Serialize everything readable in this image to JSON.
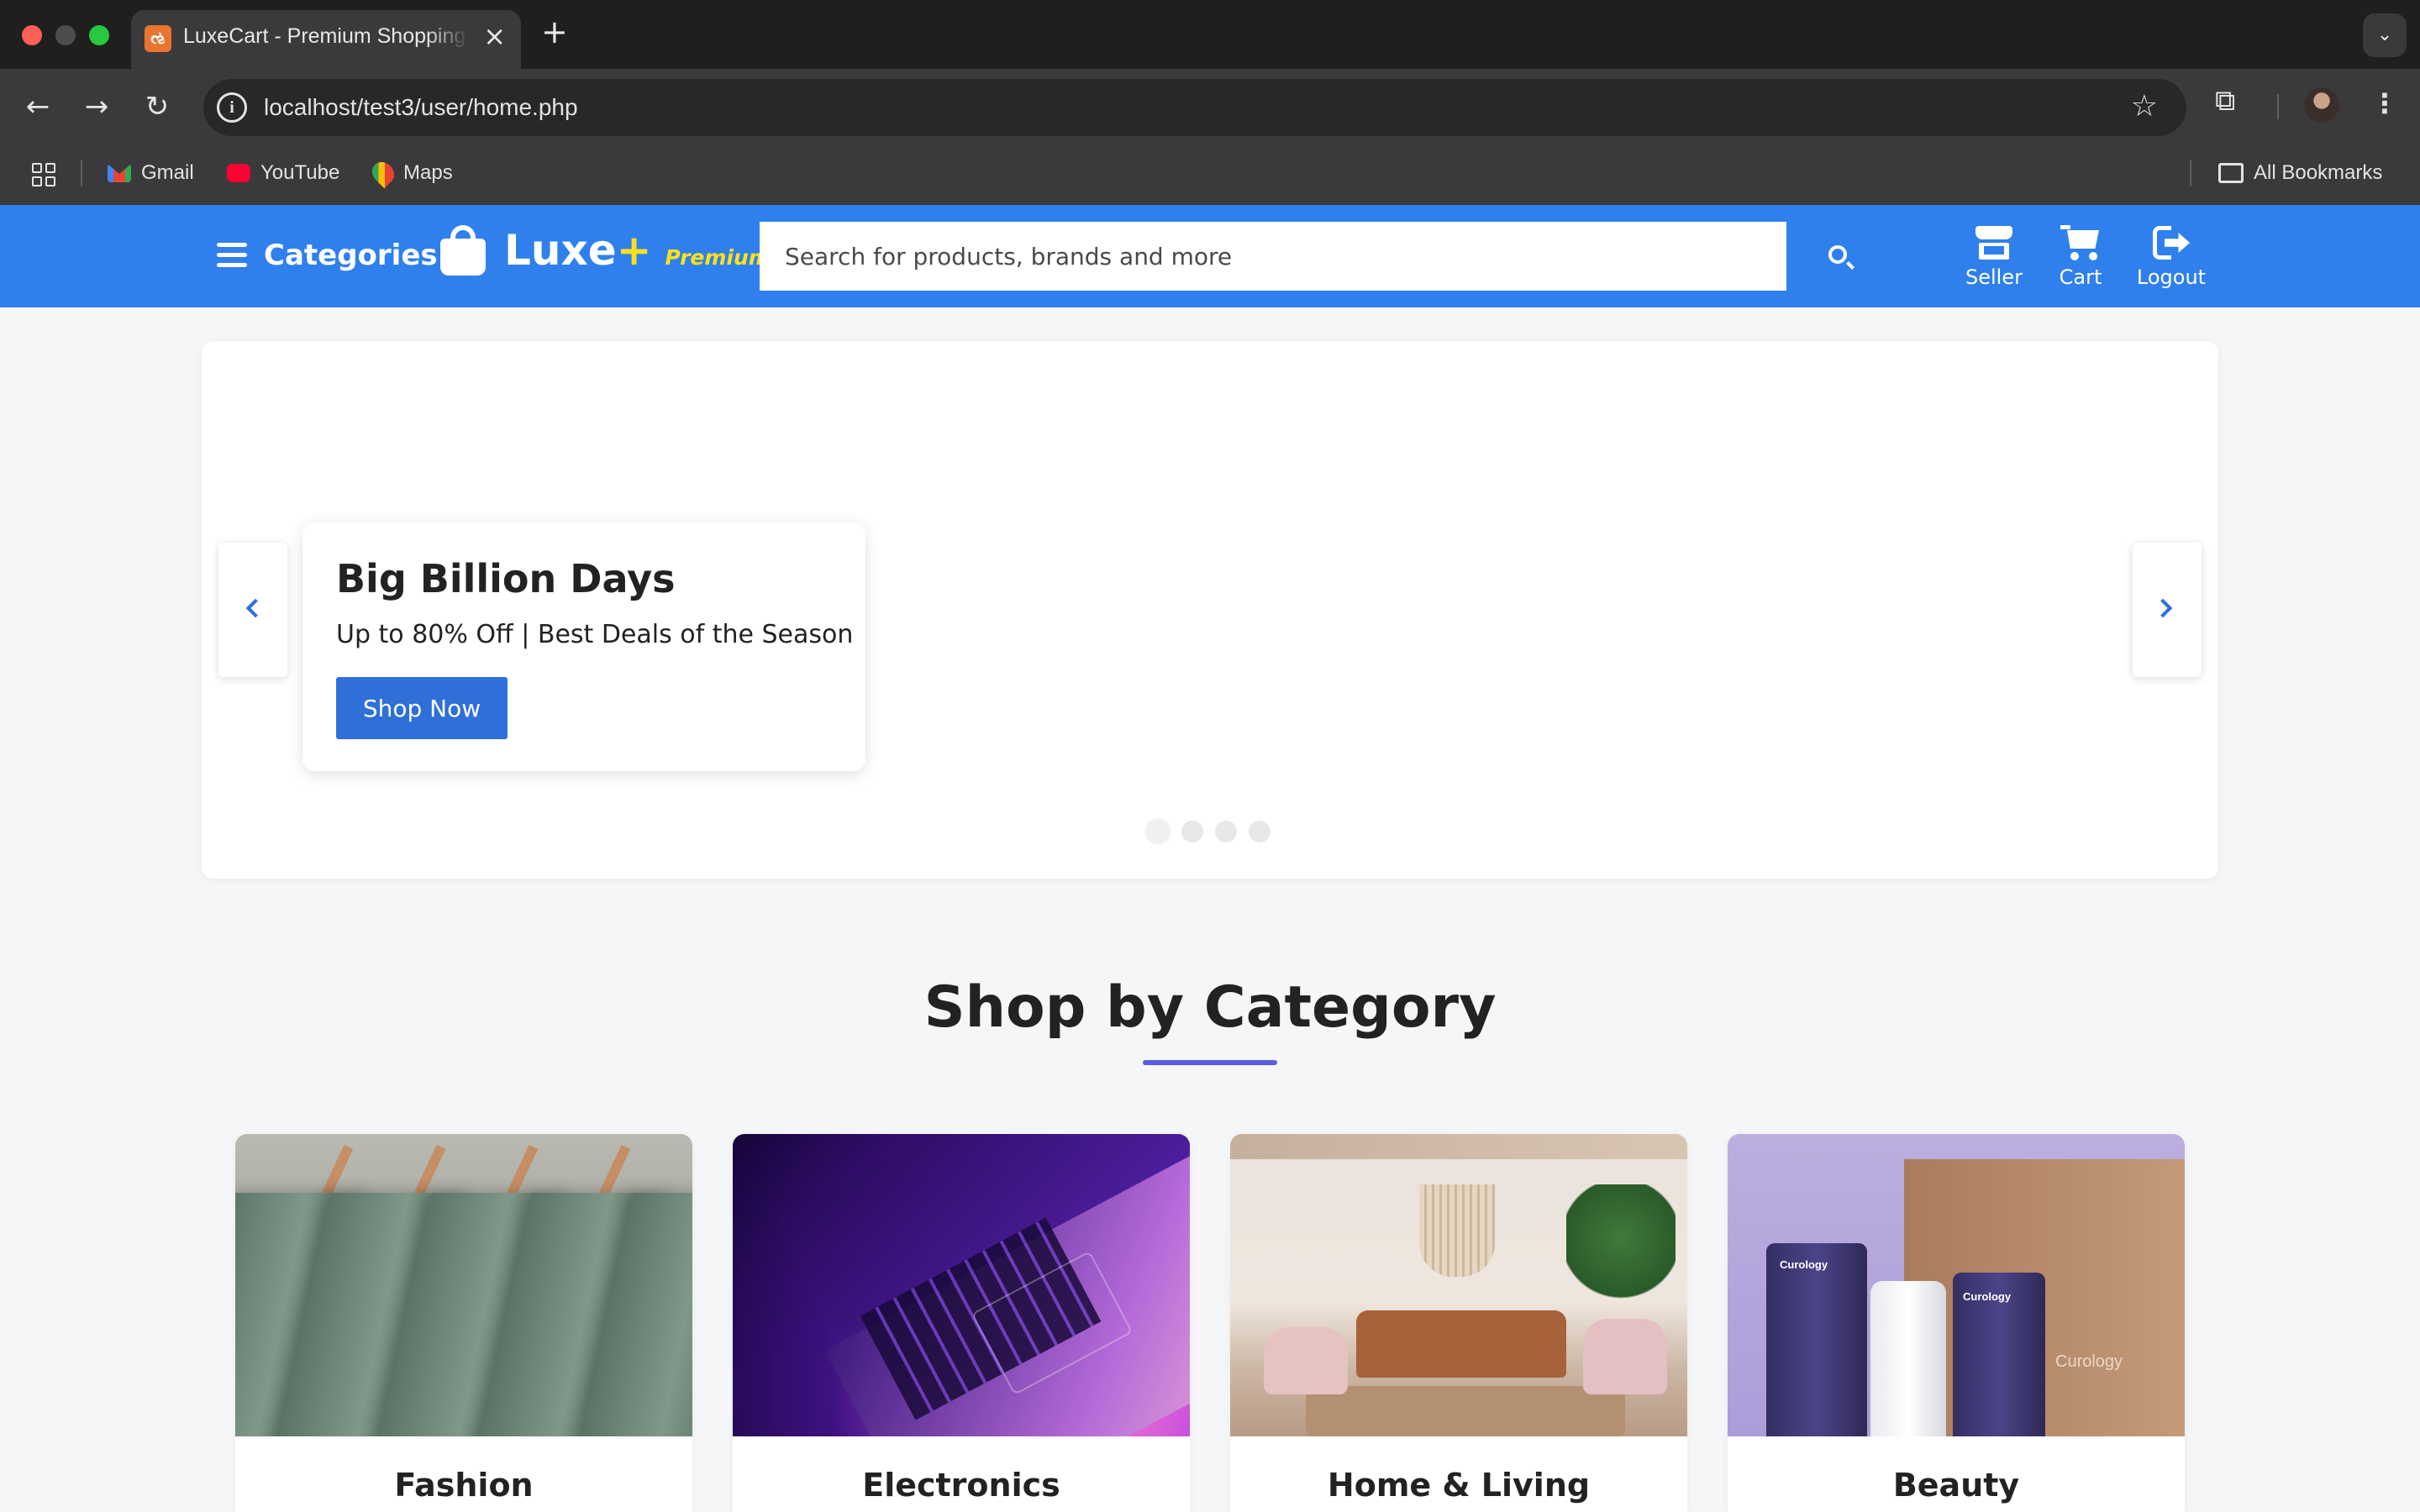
{
  "browser": {
    "tab_title": "LuxeCart - Premium Shopping",
    "tab_favicon": "xampp-icon",
    "url": "localhost/test3/user/home.php",
    "bookmarks": [
      {
        "label": "Gmail",
        "icon": "gmail-icon"
      },
      {
        "label": "YouTube",
        "icon": "youtube-icon"
      },
      {
        "label": "Maps",
        "icon": "maps-icon"
      }
    ],
    "all_bookmarks": "All Bookmarks"
  },
  "header": {
    "categories_label": "Categories",
    "logo_text": "Luxe",
    "logo_plus": "+",
    "logo_premium": "Premium",
    "search_placeholder": "Search for products, brands and more",
    "actions": [
      {
        "label": "Seller",
        "icon": "store-icon"
      },
      {
        "label": "Cart",
        "icon": "cart-icon"
      },
      {
        "label": "Logout",
        "icon": "logout-icon"
      }
    ],
    "accent_color": "#2f80ed",
    "highlight_color": "#ffe11b"
  },
  "hero": {
    "title": "Big Billion Days",
    "subtitle": "Up to 80% Off | Best Deals of the Season",
    "button_label": "Shop Now",
    "slide_count": 4,
    "active_slide": 1
  },
  "categories_section": {
    "title": "Shop by Category",
    "items": [
      {
        "name": "Fashion"
      },
      {
        "name": "Electronics"
      },
      {
        "name": "Home & Living"
      },
      {
        "name": "Beauty",
        "product_brand": "Curology"
      }
    ]
  }
}
